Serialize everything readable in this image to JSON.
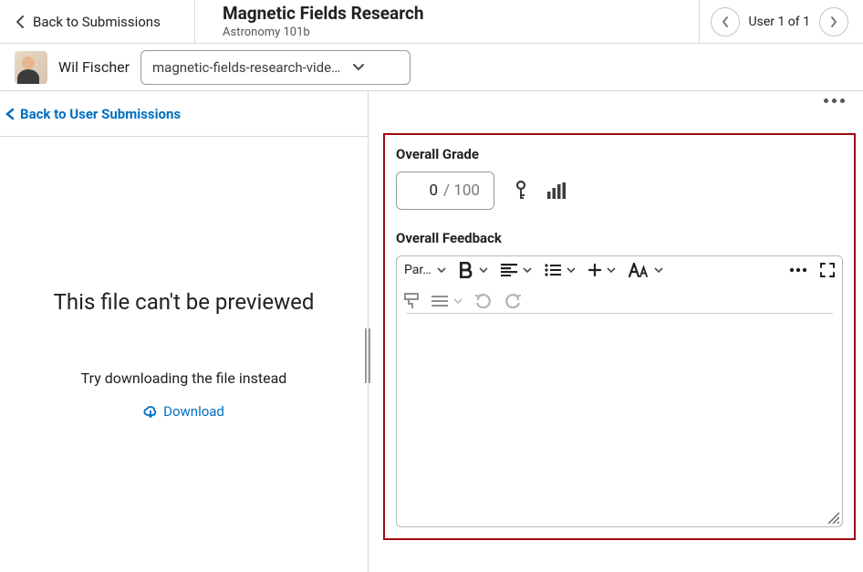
{
  "header": {
    "back_label": "Back to Submissions",
    "title": "Magnetic Fields Research",
    "subtitle": "Astronomy 101b",
    "user_counter": "User 1 of 1"
  },
  "subheader": {
    "user_name": "Wil Fischer",
    "file_dropdown_text": "magnetic-fields-research-vide…"
  },
  "left": {
    "back_user_link": "Back to User Submissions",
    "preview_title": "This file can't be previewed",
    "preview_subtext": "Try downloading the file instead",
    "download_label": "Download"
  },
  "grading": {
    "overall_grade_label": "Overall Grade",
    "grade_value": "0",
    "grade_denom": "/ 100",
    "overall_feedback_label": "Overall Feedback"
  },
  "editor": {
    "paragraph_label": "Par…",
    "feedback_value": ""
  }
}
